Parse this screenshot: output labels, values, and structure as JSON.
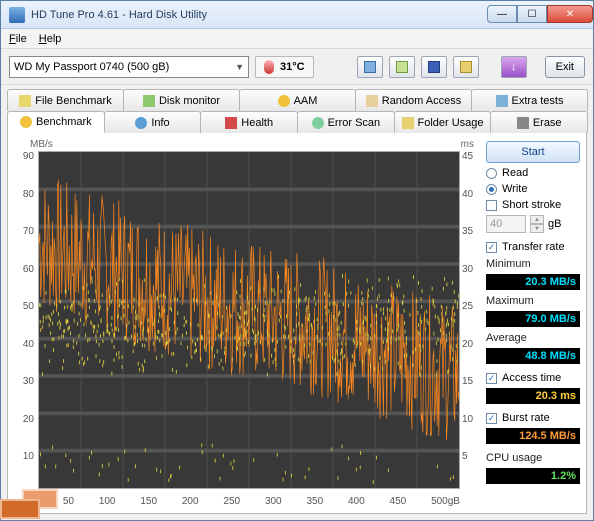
{
  "window": {
    "title": "HD Tune Pro 4.61 - Hard Disk Utility"
  },
  "menu": {
    "file": "File",
    "help": "Help"
  },
  "toolbar": {
    "drive": "WD     My Passport 0740 (500 gB)",
    "temp": "31°C",
    "exit": "Exit"
  },
  "tabs_row1": {
    "file_benchmark": "File Benchmark",
    "disk_monitor": "Disk monitor",
    "aam": "AAM",
    "random_access": "Random Access",
    "extra_tests": "Extra tests"
  },
  "tabs_row2": {
    "benchmark": "Benchmark",
    "info": "Info",
    "health": "Health",
    "error_scan": "Error Scan",
    "folder_usage": "Folder Usage",
    "erase": "Erase"
  },
  "side": {
    "start": "Start",
    "read": "Read",
    "write": "Write",
    "short_stroke": "Short stroke",
    "stroke_val": "40",
    "stroke_unit": "gB",
    "transfer_rate": "Transfer rate",
    "minimum": "Minimum",
    "minimum_val": "20.3 MB/s",
    "maximum": "Maximum",
    "maximum_val": "79.0 MB/s",
    "average": "Average",
    "average_val": "48.8 MB/s",
    "access_time": "Access time",
    "access_time_val": "20.3 ms",
    "burst_rate": "Burst rate",
    "burst_rate_val": "124.5 MB/s",
    "cpu_usage": "CPU usage",
    "cpu_usage_val": "1.2%"
  },
  "chart": {
    "y_left_label": "MB/s",
    "y_right_label": "ms",
    "y_left_ticks": [
      "90",
      "80",
      "70",
      "60",
      "50",
      "40",
      "30",
      "20",
      "10",
      ""
    ],
    "y_right_ticks": [
      "45",
      "40",
      "35",
      "30",
      "25",
      "20",
      "15",
      "10",
      "5",
      ""
    ],
    "x_ticks": [
      "",
      "50",
      "100",
      "150",
      "200",
      "250",
      "300",
      "350",
      "400",
      "450",
      "500gB"
    ]
  },
  "chart_data": {
    "type": "line",
    "title": "",
    "xlabel": "gB",
    "ylabel_left": "MB/s",
    "ylabel_right": "ms",
    "xlim": [
      0,
      500
    ],
    "ylim_left": [
      0,
      90
    ],
    "ylim_right": [
      0,
      45
    ],
    "series": [
      {
        "name": "Transfer rate (MB/s)",
        "axis": "left",
        "style": "very-noisy-line",
        "color": "#ff8a1f",
        "x": [
          0,
          25,
          50,
          75,
          100,
          125,
          150,
          175,
          200,
          225,
          250,
          275,
          300,
          325,
          350,
          375,
          400,
          425,
          450,
          475,
          500
        ],
        "y": [
          66,
          64,
          62,
          60,
          58,
          56,
          54,
          52,
          50,
          49,
          48,
          46,
          45,
          44,
          42,
          40,
          38,
          36,
          34,
          32,
          30
        ],
        "noise_band": [
          20,
          79
        ]
      },
      {
        "name": "Access time (ms)",
        "axis": "right",
        "style": "scatter",
        "color": "#e4d23f",
        "stats": {
          "mean": 20.3,
          "min": 1,
          "max": 44
        },
        "cluster_band_ms": [
          20,
          25
        ],
        "outlier_band_ms": [
          1,
          6
        ]
      }
    ],
    "summary": {
      "min_mbs": 20.3,
      "max_mbs": 79.0,
      "avg_mbs": 48.8,
      "access_ms": 20.3,
      "burst_mbs": 124.5,
      "cpu_pct": 1.2
    }
  }
}
